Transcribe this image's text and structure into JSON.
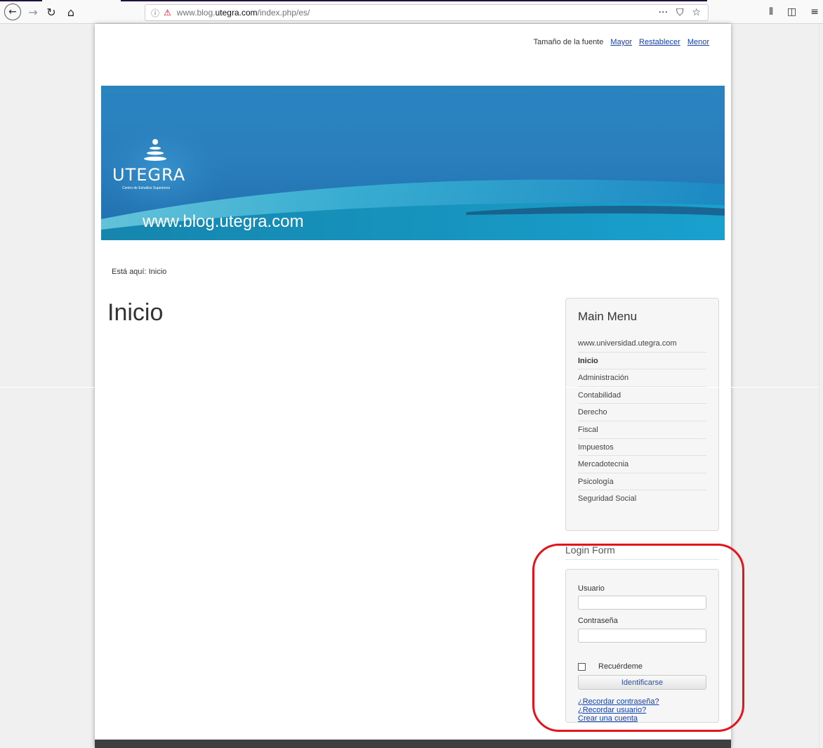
{
  "browser": {
    "back_icon": "←",
    "forward_icon": "→",
    "reload_icon": "↻",
    "home_icon": "⌂",
    "info_icon": "ⓘ",
    "insecure_icon": "⚠",
    "url_prefix": "www.blog.",
    "url_host": "utegra.com",
    "url_suffix": "/index.php/es/",
    "page_actions_icon": "···",
    "pocket_icon": "⛉",
    "bookmark_icon": "☆",
    "library_icon": "⫴",
    "sidebar_icon": "◫",
    "menu_icon": "≡"
  },
  "font_size": {
    "label": "Tamaño de la fuente",
    "bigger": "Mayor",
    "reset": "Restablecer",
    "smaller": "Menor"
  },
  "banner": {
    "logo_name": "UTEGRA",
    "logo_subtitle": "Centro de Estudios Superiores",
    "site_url": "www.blog.utegra.com"
  },
  "breadcrumb": "Está aquí: Inicio",
  "page_title": "Inicio",
  "main_menu": {
    "title": "Main Menu",
    "items": [
      {
        "label": "www.universidad.utegra.com"
      },
      {
        "label": "Inicio"
      },
      {
        "label": "Administración"
      },
      {
        "label": "Contabilidad"
      },
      {
        "label": "Derecho"
      },
      {
        "label": "Fiscal"
      },
      {
        "label": "Impuestos"
      },
      {
        "label": "Mercadotecnia"
      },
      {
        "label": "Psicología"
      },
      {
        "label": "Seguridad Social"
      }
    ]
  },
  "login": {
    "title": "Login Form",
    "username_label": "Usuario",
    "username_value": "",
    "password_label": "Contraseña",
    "password_value": "",
    "remember_label": "Recuérdeme",
    "submit_label": "Identificarse",
    "forgot_password": "¿Recordar contraseña?",
    "forgot_username": "¿Recordar usuario?",
    "create_account": "Crear una cuenta"
  },
  "colors": {
    "banner": "#2a7fbc",
    "link": "#0f3fb0",
    "highlight": "#e3141b"
  }
}
